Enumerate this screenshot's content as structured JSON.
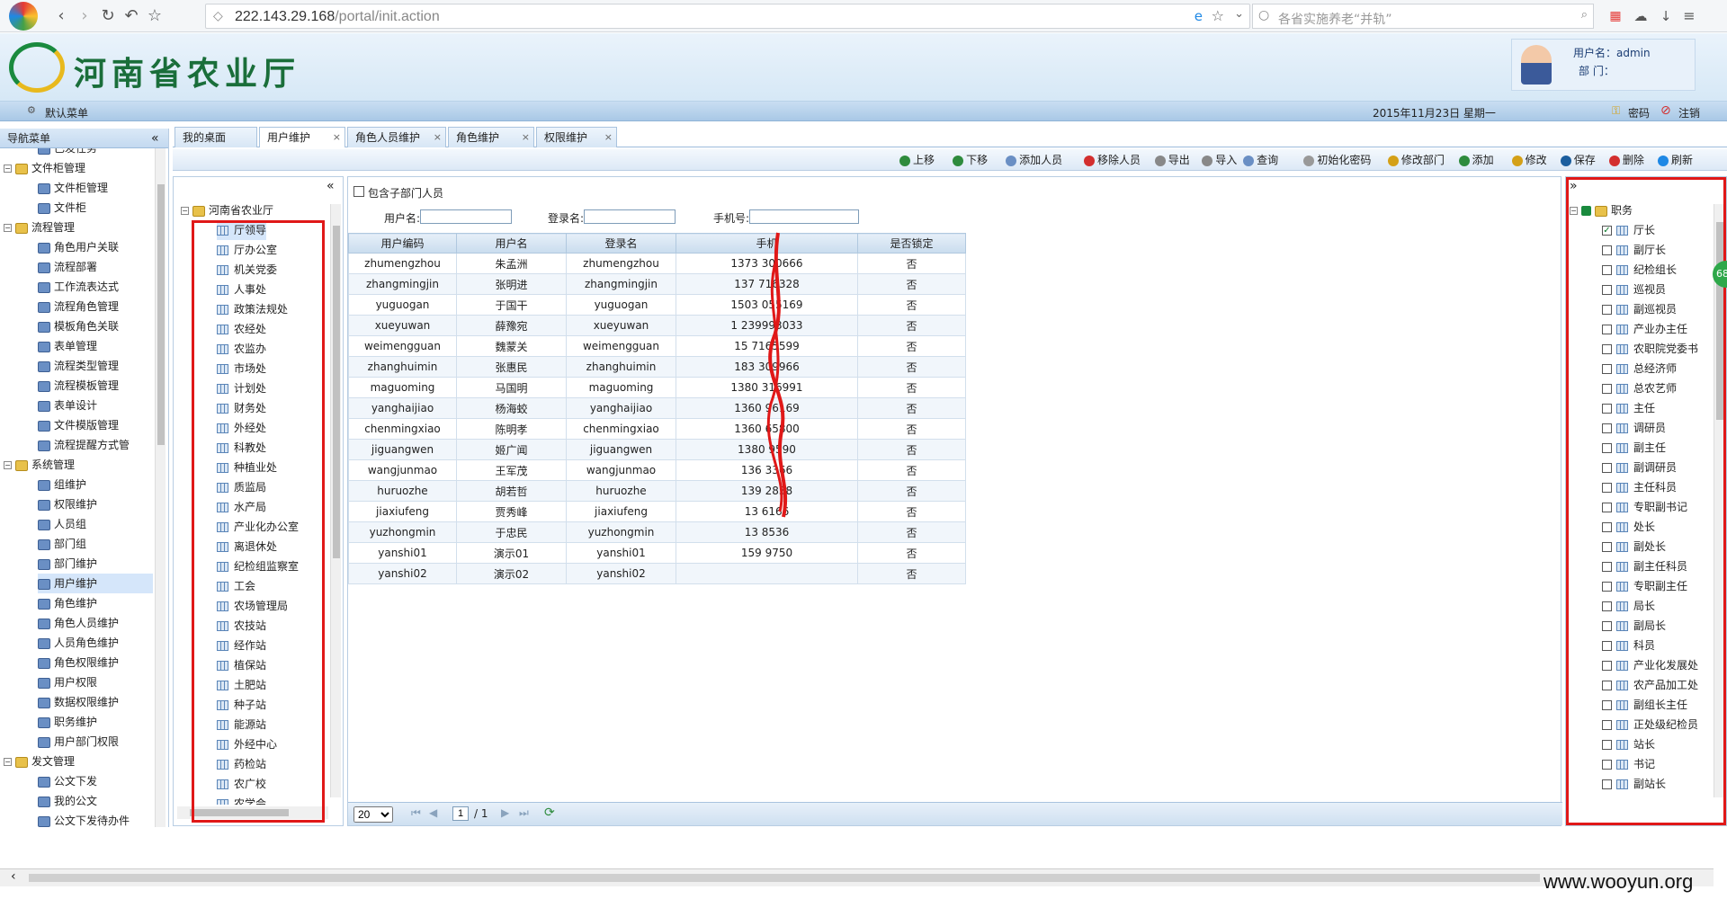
{
  "browser": {
    "url_host": "222.143.29.168",
    "url_path": "/portal/init.action",
    "search_placeholder": "各省实施养老“并轨”"
  },
  "header": {
    "title": "河南省农业厅",
    "username_label": "用户名：admin",
    "dept_label": "部  门：",
    "menu_label": "默认菜单",
    "date": "2015年11月23日 星期一",
    "password_link": "密码",
    "logout_link": "注销"
  },
  "nav": {
    "title": "导航菜单",
    "items": [
      {
        "label": "已发任务",
        "level": 2
      },
      {
        "label": "文件柜管理",
        "level": 1
      },
      {
        "label": "文件柜管理",
        "level": 2
      },
      {
        "label": "文件柜",
        "level": 2
      },
      {
        "label": "流程管理",
        "level": 1
      },
      {
        "label": "角色用户关联",
        "level": 2
      },
      {
        "label": "流程部署",
        "level": 2
      },
      {
        "label": "工作流表达式",
        "level": 2
      },
      {
        "label": "流程角色管理",
        "level": 2
      },
      {
        "label": "模板角色关联",
        "level": 2
      },
      {
        "label": "表单管理",
        "level": 2
      },
      {
        "label": "流程类型管理",
        "level": 2
      },
      {
        "label": "流程模板管理",
        "level": 2
      },
      {
        "label": "表单设计",
        "level": 2
      },
      {
        "label": "文件模版管理",
        "level": 2
      },
      {
        "label": "流程提醒方式管",
        "level": 2
      },
      {
        "label": "系统管理",
        "level": 1
      },
      {
        "label": "组维护",
        "level": 2
      },
      {
        "label": "权限维护",
        "level": 2
      },
      {
        "label": "人员组",
        "level": 2
      },
      {
        "label": "部门组",
        "level": 2
      },
      {
        "label": "部门维护",
        "level": 2
      },
      {
        "label": "用户维护",
        "level": 2
      },
      {
        "label": "角色维护",
        "level": 2
      },
      {
        "label": "角色人员维护",
        "level": 2
      },
      {
        "label": "人员角色维护",
        "level": 2
      },
      {
        "label": "角色权限维护",
        "level": 2
      },
      {
        "label": "用户权限",
        "level": 2
      },
      {
        "label": "数据权限维护",
        "level": 2
      },
      {
        "label": "职务维护",
        "level": 2
      },
      {
        "label": "用户部门权限",
        "level": 2
      },
      {
        "label": "发文管理",
        "level": 1
      },
      {
        "label": "公文下发",
        "level": 2
      },
      {
        "label": "我的公文",
        "level": 2
      },
      {
        "label": "公文下发待办件",
        "level": 2
      }
    ]
  },
  "tabs": [
    {
      "label": "我的桌面",
      "closable": false
    },
    {
      "label": "用户维护",
      "closable": true
    },
    {
      "label": "角色人员维护",
      "closable": true
    },
    {
      "label": "角色维护",
      "closable": true
    },
    {
      "label": "权限维护",
      "closable": true
    }
  ],
  "toolbar": [
    "上移",
    "下移",
    "添加人员",
    "移除人员",
    "导出",
    "导入",
    "查询",
    "初始化密码",
    "修改部门",
    "添加",
    "修改",
    "保存",
    "删除",
    "刷新"
  ],
  "org_tree": {
    "root": "河南省农业厅",
    "items": [
      "厅领导",
      "厅办公室",
      "机关党委",
      "人事处",
      "政策法规处",
      "农经处",
      "农监办",
      "市场处",
      "计划处",
      "财务处",
      "外经处",
      "科教处",
      "种植业处",
      "质监局",
      "水产局",
      "产业化办公室",
      "离退休处",
      "纪检组监察室",
      "工会",
      "农场管理局",
      "农技站",
      "经作站",
      "植保站",
      "土肥站",
      "种子站",
      "能源站",
      "外经中心",
      "药检站",
      "农广校",
      "农学会"
    ]
  },
  "filters": {
    "include_sub": "包含子部门人员",
    "username_label": "用户名:",
    "login_label": "登录名:",
    "phone_label": "手机号:"
  },
  "table": {
    "columns": [
      "用户编码",
      "用户名",
      "登录名",
      "手机",
      "是否锁定"
    ],
    "rows": [
      [
        "zhumengzhou",
        "朱孟洲",
        "zhumengzhou",
        "1373  300666",
        "否"
      ],
      [
        "zhangmingjin",
        "张明进",
        "zhangmingjin",
        "137  716328",
        "否"
      ],
      [
        "yuguogan",
        "于国干",
        "yuguogan",
        "1503  055169",
        "否"
      ],
      [
        "xueyuwan",
        "薛豫宛",
        "xueyuwan",
        "1  239993033",
        "否"
      ],
      [
        "weimengguan",
        "魏蒙关",
        "weimengguan",
        "15  7165599",
        "否"
      ],
      [
        "zhanghuimin",
        "张惠民",
        "zhanghuimin",
        "183  309966",
        "否"
      ],
      [
        "maguoming",
        "马国明",
        "maguoming",
        "1380  316991",
        "否"
      ],
      [
        "yanghaijiao",
        "杨海蛟",
        "yanghaijiao",
        "1360  96169",
        "否"
      ],
      [
        "chenmingxiao",
        "陈明孝",
        "chenmingxiao",
        "1360  65800",
        "否"
      ],
      [
        "jiguangwen",
        "姬广闻",
        "jiguangwen",
        "1380  9590",
        "否"
      ],
      [
        "wangjunmao",
        "王军茂",
        "wangjunmao",
        "136  3366",
        "否"
      ],
      [
        "huruozhe",
        "胡若哲",
        "huruozhe",
        "139  2838",
        "否"
      ],
      [
        "jiaxiufeng",
        "贾秀峰",
        "jiaxiufeng",
        "13  6166",
        "否"
      ],
      [
        "yuzhongmin",
        "于忠民",
        "yuzhongmin",
        "13  8536",
        "否"
      ],
      [
        "yanshi01",
        "演示01",
        "yanshi01",
        "159  9750",
        "否"
      ],
      [
        "yanshi02",
        "演示02",
        "yanshi02",
        "",
        "否"
      ]
    ]
  },
  "pager": {
    "page_size": "20",
    "current_page": "1",
    "total_pages": "/ 1"
  },
  "roles": {
    "root": "职务",
    "items": [
      {
        "label": "厅长",
        "checked": true
      },
      {
        "label": "副厅长",
        "checked": false
      },
      {
        "label": "纪检组长",
        "checked": false
      },
      {
        "label": "巡视员",
        "checked": false
      },
      {
        "label": "副巡视员",
        "checked": false
      },
      {
        "label": "产业办主任",
        "checked": false
      },
      {
        "label": "农职院党委书",
        "checked": false
      },
      {
        "label": "总经济师",
        "checked": false
      },
      {
        "label": "总农艺师",
        "checked": false
      },
      {
        "label": "主任",
        "checked": false
      },
      {
        "label": "调研员",
        "checked": false
      },
      {
        "label": "副主任",
        "checked": false
      },
      {
        "label": "副调研员",
        "checked": false
      },
      {
        "label": "主任科员",
        "checked": false
      },
      {
        "label": "专职副书记",
        "checked": false
      },
      {
        "label": "处长",
        "checked": false
      },
      {
        "label": "副处长",
        "checked": false
      },
      {
        "label": "副主任科员",
        "checked": false
      },
      {
        "label": "专职副主任",
        "checked": false
      },
      {
        "label": "局长",
        "checked": false
      },
      {
        "label": "副局长",
        "checked": false
      },
      {
        "label": "科员",
        "checked": false
      },
      {
        "label": "产业化发展处",
        "checked": false
      },
      {
        "label": "农产品加工处",
        "checked": false
      },
      {
        "label": "副组长主任",
        "checked": false
      },
      {
        "label": "正处级纪检员",
        "checked": false
      },
      {
        "label": "站长",
        "checked": false
      },
      {
        "label": "书记",
        "checked": false
      },
      {
        "label": "副站长",
        "checked": false
      }
    ]
  },
  "watermark": "www.wooyun.org",
  "colors": {
    "accent": "#1a6e3a",
    "annotation": "#e01818",
    "selection": "#d5e6fa"
  }
}
